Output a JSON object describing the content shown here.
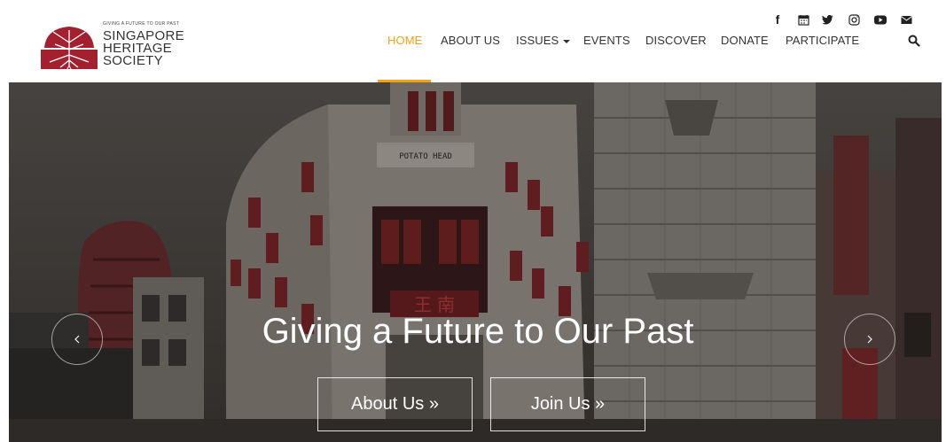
{
  "logo": {
    "tagline": "GIVING A FUTURE TO OUR PAST",
    "lines": [
      "SINGAPORE",
      "HERITAGE",
      "SOCIETY"
    ]
  },
  "social": [
    {
      "icon": "facebook-icon",
      "glyph": "f"
    },
    {
      "icon": "calendar-icon",
      "glyph": "▦"
    },
    {
      "icon": "twitter-icon",
      "glyph": "▼"
    },
    {
      "icon": "instagram-icon",
      "glyph": "◎"
    },
    {
      "icon": "youtube-icon",
      "glyph": "▶"
    },
    {
      "icon": "envelope-icon",
      "glyph": "✉"
    }
  ],
  "nav": {
    "home": "HOME",
    "about": "ABOUT US",
    "issues": "ISSUES",
    "events": "EVENTS",
    "discover": "DISCOVER",
    "donate": "DONATE",
    "participate": "PARTICIPATE"
  },
  "hero": {
    "headline": "Giving a Future to Our Past",
    "about_btn": "About Us »",
    "join_btn": "Join Us »",
    "sign_text": "POTATO HEAD"
  },
  "colors": {
    "accent": "#f0a315",
    "brand": "#a3202f"
  }
}
